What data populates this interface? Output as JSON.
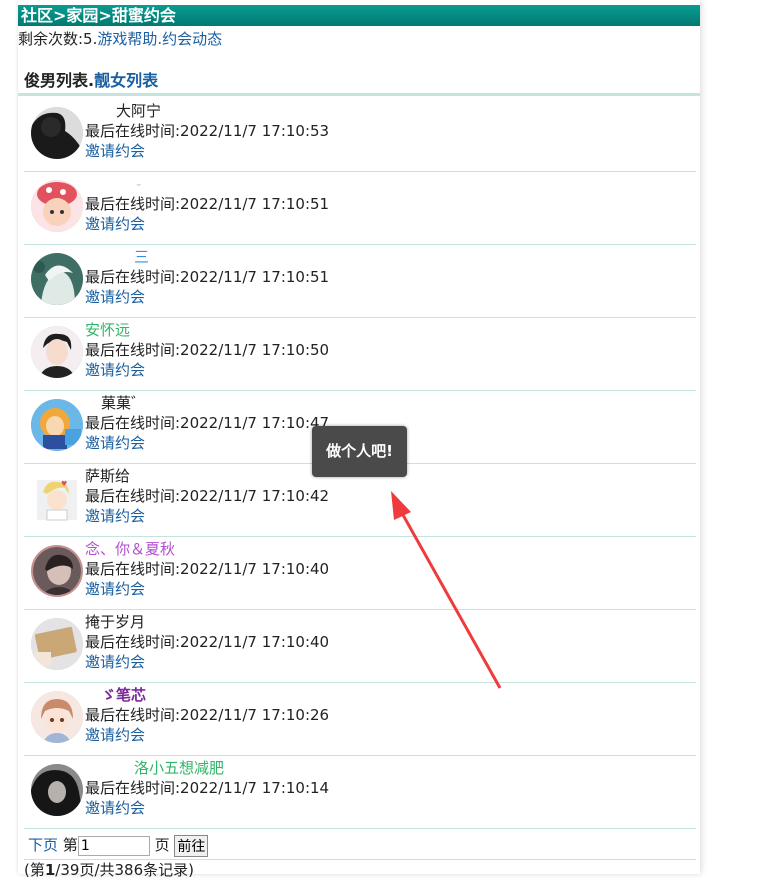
{
  "breadcrumb": "社区>家园>甜蜜约会",
  "topline": {
    "remaining": "剩余次数:5.",
    "help_link": "游戏帮助",
    "sep": ".",
    "news_link": "约会动态"
  },
  "list_header": {
    "active_tab": "俊男列表",
    "sep": ".",
    "other_tab": "靓女列表"
  },
  "users": [
    {
      "name": "大阿宁",
      "name_color": "#222222",
      "last_online": "最后在线时间:2022/11/7 17:10:53",
      "invite": "邀请约会"
    },
    {
      "name": "-",
      "name_color": "#cccccc",
      "last_online": "最后在线时间:2022/11/7 17:10:51",
      "invite": "邀请约会"
    },
    {
      "name": "三",
      "name_color": "#3a8fd8",
      "last_online": "最后在线时间:2022/11/7 17:10:51",
      "invite": "邀请约会"
    },
    {
      "name": "安怀远",
      "name_color": "#2fb567",
      "last_online": "最后在线时间:2022/11/7 17:10:50",
      "invite": "邀请约会"
    },
    {
      "name": "菓菓゛",
      "name_color": "#222222",
      "last_online": "最后在线时间:2022/11/7 17:10:47",
      "invite": "邀请约会"
    },
    {
      "name": "萨斯给",
      "name_color": "#222222",
      "last_online": "最后在线时间:2022/11/7 17:10:42",
      "invite": "邀请约会"
    },
    {
      "name": "念、你＆夏秋",
      "name_color": "#b34fd0",
      "last_online": "最后在线时间:2022/11/7 17:10:40",
      "invite": "邀请约会"
    },
    {
      "name": "掩于岁月",
      "name_color": "#222222",
      "last_online": "最后在线时间:2022/11/7 17:10:40",
      "invite": "邀请约会"
    },
    {
      "name": "ゞ笔芯",
      "name_color": "#7a2a9a",
      "last_online": "最后在线时间:2022/11/7 17:10:26",
      "invite": "邀请约会"
    },
    {
      "name": "洛小五想减肥",
      "name_color": "#2fb567",
      "last_online": "最后在线时间:2022/11/7 17:10:14",
      "invite": "邀请约会"
    }
  ],
  "pager": {
    "next_link": "下页",
    "page_prefix": "第",
    "page_input_value": "1",
    "page_suffix": "页",
    "go_button": "前往"
  },
  "records": {
    "open": "(第",
    "current_page": "1",
    "rest": "/39页/共386条记录)"
  },
  "tooltip": "做个人吧!",
  "colors": {
    "header_bg": "#00877f",
    "link": "#1a5fa0",
    "divider": "#c6e3df",
    "annotation_arrow": "#ef3b3b",
    "tooltip_bg": "#4a4a4a"
  }
}
